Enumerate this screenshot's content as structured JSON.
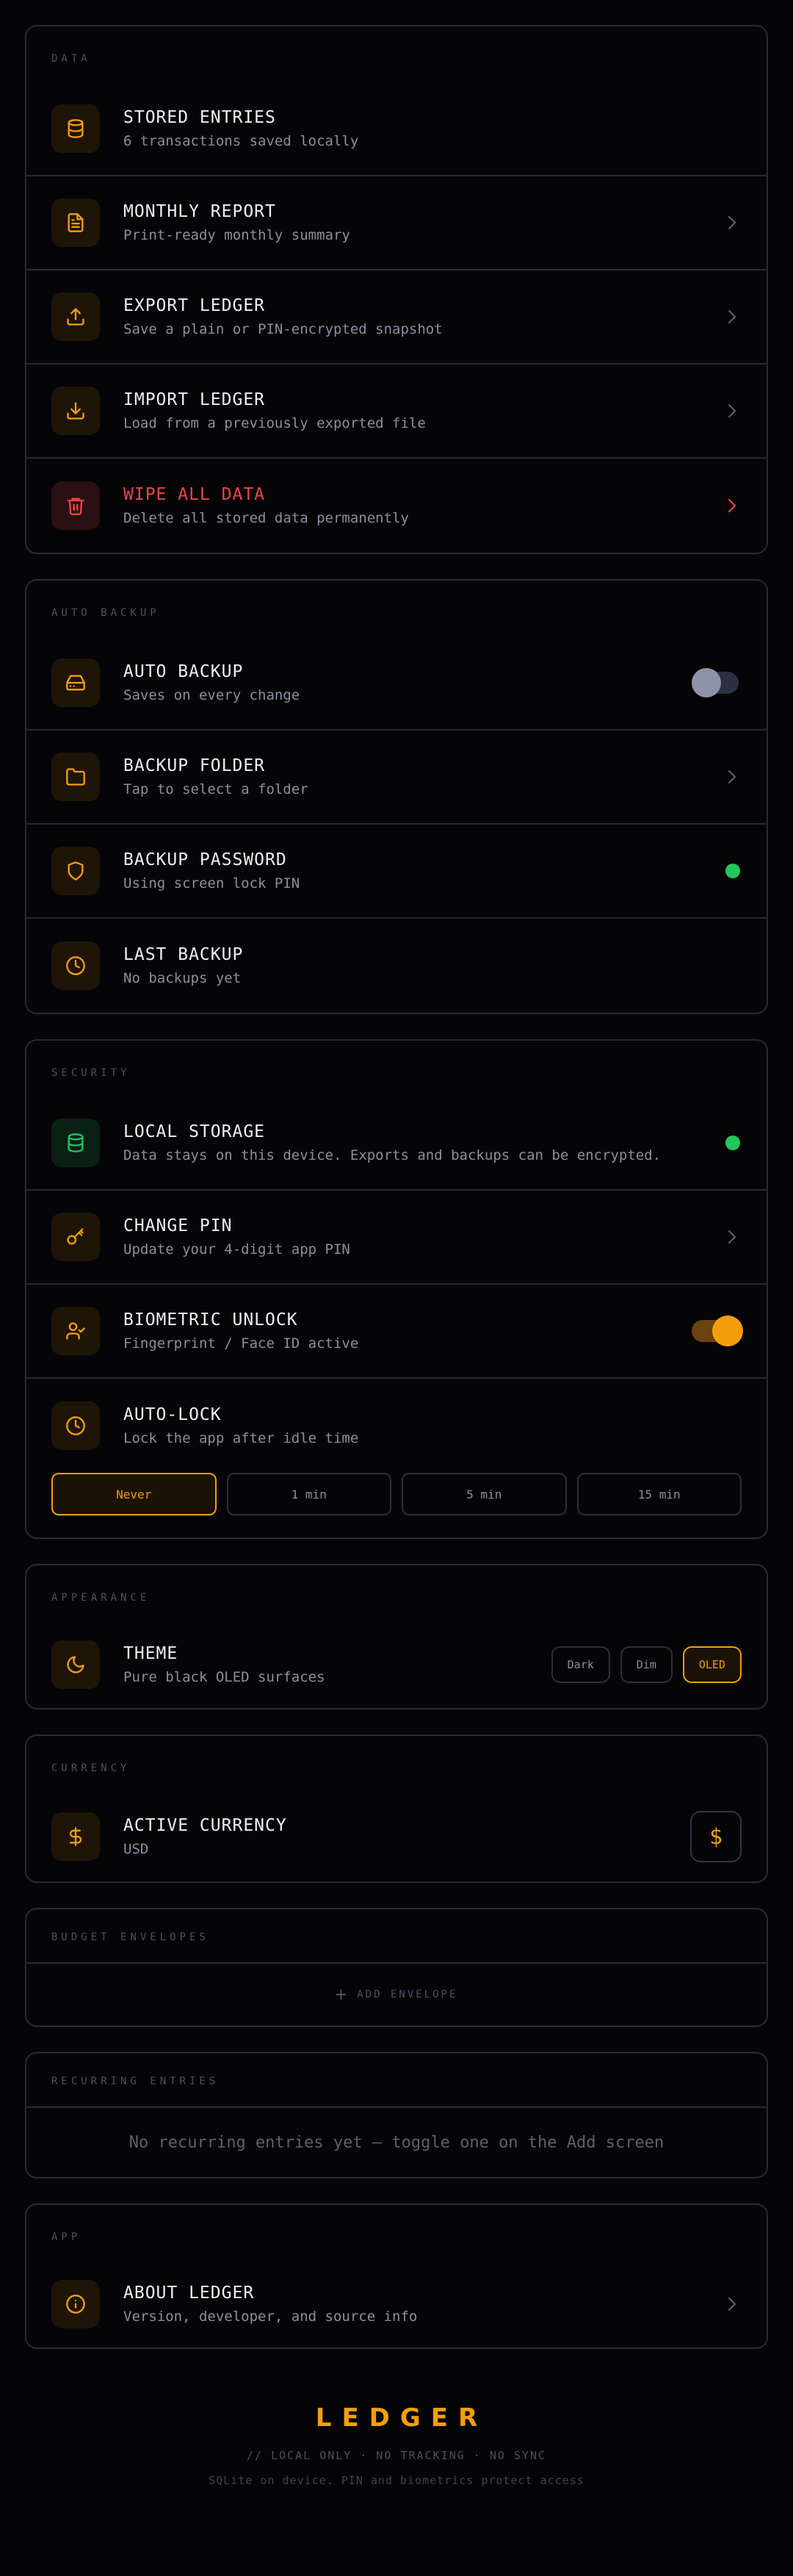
{
  "data_section": {
    "title": "DATA",
    "stored": {
      "title": "STORED ENTRIES",
      "subtitle": "6 transactions saved locally"
    },
    "report": {
      "title": "MONTHLY REPORT",
      "subtitle": "Print-ready monthly summary"
    },
    "export": {
      "title": "EXPORT LEDGER",
      "subtitle": "Save a plain or PIN-encrypted snapshot"
    },
    "import": {
      "title": "IMPORT LEDGER",
      "subtitle": "Load from a previously exported file"
    },
    "wipe": {
      "title": "WIPE ALL DATA",
      "subtitle": "Delete all stored data permanently"
    }
  },
  "backup_section": {
    "title": "AUTO BACKUP",
    "auto": {
      "title": "AUTO BACKUP",
      "subtitle": "Saves on every change",
      "enabled": false
    },
    "folder": {
      "title": "BACKUP FOLDER",
      "subtitle": "Tap to select a folder"
    },
    "password": {
      "title": "BACKUP PASSWORD",
      "subtitle": "Using screen lock PIN"
    },
    "last": {
      "title": "LAST BACKUP",
      "subtitle": "No backups yet"
    }
  },
  "security_section": {
    "title": "SECURITY",
    "storage": {
      "title": "LOCAL STORAGE",
      "subtitle": "Data stays on this device. Exports and backups can be encrypted."
    },
    "pin": {
      "title": "CHANGE PIN",
      "subtitle": "Update your 4-digit app PIN"
    },
    "biometric": {
      "title": "BIOMETRIC UNLOCK",
      "subtitle": "Fingerprint / Face ID active",
      "enabled": true
    },
    "autolock": {
      "title": "AUTO-LOCK",
      "subtitle": "Lock the app after idle time",
      "options": [
        "Never",
        "1 min",
        "5 min",
        "15 min"
      ],
      "selected": "Never"
    }
  },
  "appearance_section": {
    "title": "APPEARANCE",
    "theme": {
      "title": "THEME",
      "subtitle": "Pure black OLED surfaces",
      "options": [
        "Dark",
        "Dim",
        "OLED"
      ],
      "selected": "OLED"
    }
  },
  "currency_section": {
    "title": "CURRENCY",
    "active": {
      "title": "ACTIVE CURRENCY",
      "subtitle": "USD",
      "symbol": "$"
    }
  },
  "envelopes_section": {
    "title": "BUDGET ENVELOPES",
    "add_label": "ADD ENVELOPE"
  },
  "recurring_section": {
    "title": "RECURRING ENTRIES",
    "empty_text": "No recurring entries yet — toggle one on the Add screen"
  },
  "app_section": {
    "title": "APP",
    "about": {
      "title": "ABOUT LEDGER",
      "subtitle": "Version, developer, and source info"
    }
  },
  "footer": {
    "brand": "LEDGER",
    "line1": "// LOCAL ONLY · NO TRACKING · NO SYNC",
    "line2": "SQLite on device. PIN and biometrics protect access"
  },
  "colors": {
    "accent": "#f59e0b",
    "danger": "#ef4444",
    "success": "#22c55e",
    "background": "#050507",
    "border": "#262a38"
  }
}
